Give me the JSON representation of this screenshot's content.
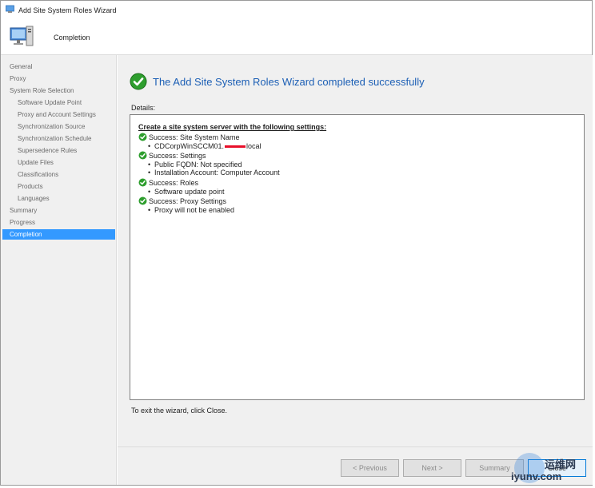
{
  "window": {
    "title": "Add Site System Roles Wizard"
  },
  "header": {
    "page_heading": "Completion"
  },
  "sidebar": {
    "items": [
      {
        "label": "General",
        "sub": false,
        "active": false
      },
      {
        "label": "Proxy",
        "sub": false,
        "active": false
      },
      {
        "label": "System Role Selection",
        "sub": false,
        "active": false
      },
      {
        "label": "Software Update Point",
        "sub": true,
        "active": false
      },
      {
        "label": "Proxy and Account Settings",
        "sub": true,
        "active": false
      },
      {
        "label": "Synchronization Source",
        "sub": true,
        "active": false
      },
      {
        "label": "Synchronization Schedule",
        "sub": true,
        "active": false
      },
      {
        "label": "Supersedence Rules",
        "sub": true,
        "active": false
      },
      {
        "label": "Update Files",
        "sub": true,
        "active": false
      },
      {
        "label": "Classifications",
        "sub": true,
        "active": false
      },
      {
        "label": "Products",
        "sub": true,
        "active": false
      },
      {
        "label": "Languages",
        "sub": true,
        "active": false
      },
      {
        "label": "Summary",
        "sub": false,
        "active": false
      },
      {
        "label": "Progress",
        "sub": false,
        "active": false
      },
      {
        "label": "Completion",
        "sub": false,
        "active": true
      }
    ]
  },
  "main": {
    "result_title": "The Add Site System Roles Wizard completed successfully",
    "details_label": "Details:",
    "details_heading": "Create a site system server with the following settings:",
    "results": [
      {
        "status": "Success: Site System Name",
        "bullets": [
          "CDCorpWinSCCM01.",
          "local"
        ]
      },
      {
        "status": "Success: Settings",
        "bullets": [
          "Public FQDN: Not specified",
          "Installation Account: Computer Account"
        ]
      },
      {
        "status": "Success: Roles",
        "bullets": [
          "Software update point"
        ]
      },
      {
        "status": "Success: Proxy Settings",
        "bullets": [
          "Proxy will not be enabled"
        ]
      }
    ],
    "exit_text": "To exit the wizard, click Close."
  },
  "footer": {
    "previous_label": "< Previous",
    "next_label": "Next >",
    "summary_label": "Summary",
    "close_label": "Close"
  },
  "watermark": {
    "text_cn": "运维网",
    "text_en": "iyunv.com"
  },
  "colors": {
    "accent": "#3399ff",
    "title_blue": "#1c5fb5",
    "success_green": "#2e9e2e",
    "redaction_red": "#e8102a"
  }
}
